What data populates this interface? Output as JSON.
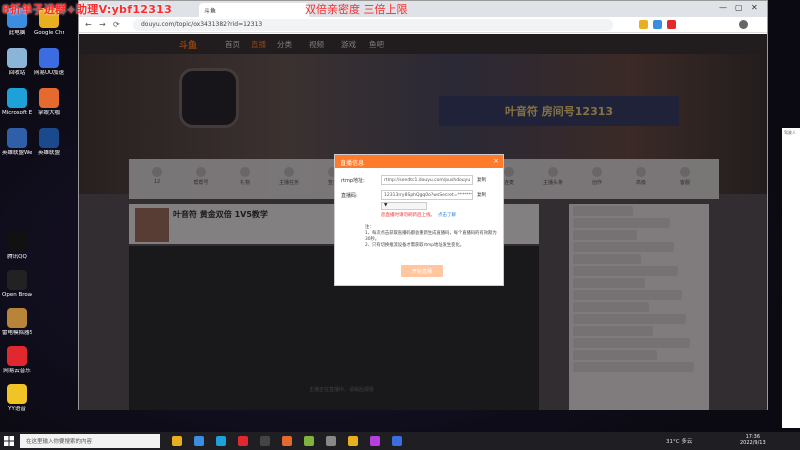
{
  "overlay": {
    "left_text": "8折单子进群+助理V:ybf12313",
    "right_text": "双倍亲密度 三倍上限"
  },
  "desktop_icons": [
    {
      "label": "此电脑",
      "color": "#3a8de0"
    },
    {
      "label": "Google Chrome",
      "color": "#e8b021"
    },
    {
      "label": "回收站",
      "color": "#8ab4d8"
    },
    {
      "label": "网易UU加速器",
      "color": "#3c6de0"
    },
    {
      "label": "Microsoft Edge",
      "color": "#1ea0d8"
    },
    {
      "label": "掌眼大咖",
      "color": "#e46b2d"
    },
    {
      "label": "英雄联盟WeGame版",
      "color": "#2f5fa8"
    },
    {
      "label": "英雄联盟",
      "color": "#1a4a8c"
    },
    {
      "label": "腾讯QQ",
      "color": "#111111"
    },
    {
      "label": "Open Broadcast...",
      "color": "#222222"
    },
    {
      "label": "雷电模拟器SAM机器",
      "color": "#b8843a"
    },
    {
      "label": "网易云音乐",
      "color": "#e0282e"
    },
    {
      "label": "YY语音",
      "color": "#f0c424"
    }
  ],
  "browser": {
    "tab_title": "斗鱼",
    "url": "douyu.com/topic/ox3431382?rid=12313",
    "nav": {
      "back": "←",
      "forward": "→",
      "reload": "⟳"
    },
    "win": {
      "min": "—",
      "max": "▢",
      "close": "✕"
    }
  },
  "site": {
    "logo": "斗鱼",
    "nav_items": [
      "首页",
      "直播",
      "分类",
      "视频",
      "游戏",
      "鱼吧"
    ],
    "hero_banner": "叶音符 房间号12313",
    "toolbar_items": [
      "12",
      "帮帮号",
      "礼物",
      "主播任务",
      "签到",
      "鱼丸",
      "分享",
      "视频",
      "连麦",
      "主播头条",
      "创作",
      "高级",
      "客服"
    ],
    "room_title": "叶音符 黄金双倍 1V5教学",
    "video_caption": "主播正在直播中，请稍后观看"
  },
  "modal": {
    "title": "直播信息",
    "close": "×",
    "rtmp_label": "rtmp地址:",
    "rtmp_value": "rtmp://sendtc1.douyu.com/pushdouyu",
    "code_label": "直播码:",
    "code_value": "12313rry8SphQgq0o?wsSecret=********",
    "copy_label": "复制",
    "select_value": "▼",
    "warn_text": "您直播时请勿刷新后上线。",
    "warn_link": "点击了解",
    "notes": [
      "注：",
      "1、每次点击获取直播码都会重新生成直播码，每个直播码的有效期为30秒。",
      "2、只有切换推流设备才需获取rtmp地址发生变化。"
    ],
    "start_button": "开始直播"
  },
  "sidewin": {
    "text": "驾驶人"
  },
  "taskbar": {
    "search_placeholder": "在这里输入你要搜索的内容",
    "temperature": "31°C 多云",
    "time": "17:36",
    "date": "2022/9/13",
    "app_colors": [
      "#e8b021",
      "#3a8de0",
      "#1ea0d8",
      "#e0282e",
      "#444",
      "#e46b2d",
      "#7fb43a",
      "#888",
      "#e8b021",
      "#b73fe0",
      "#3c6de0"
    ]
  }
}
